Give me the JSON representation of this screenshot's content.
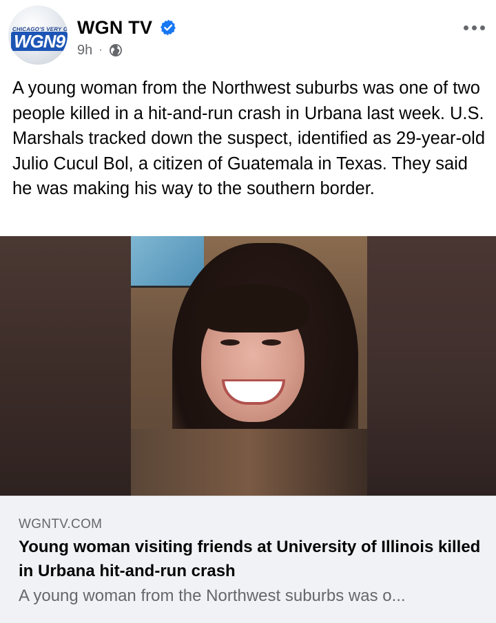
{
  "post": {
    "page_name": "WGN TV",
    "verified_icon": "verified-badge-icon",
    "verified_color": "#1877f2",
    "timestamp": "9h",
    "separator": "·",
    "audience_icon": "globe-icon",
    "more_icon": "more-options-icon",
    "avatar": {
      "logo_tagline": "CHICAGO'S VERY OWN",
      "logo_text": "WGN9"
    },
    "text": "A young woman from the Northwest suburbs was one of two people killed in a hit-and-run crash in Urbana last week. U.S. Marshals tracked down the suspect, identified as 29-year-old Julio Cucul Bol, a citizen of Guatemala in Texas. They said he was making his way to the southern border."
  },
  "link": {
    "domain": "WGNTV.COM",
    "title": "Young woman visiting friends at University of Illinois killed in Urbana hit-and-run crash",
    "description": "A young woman from the Northwest suburbs was o..."
  },
  "colors": {
    "text_primary": "#050505",
    "text_secondary": "#65676b",
    "card_background": "#f0f2f5",
    "brand_blue": "#1c55b5"
  }
}
